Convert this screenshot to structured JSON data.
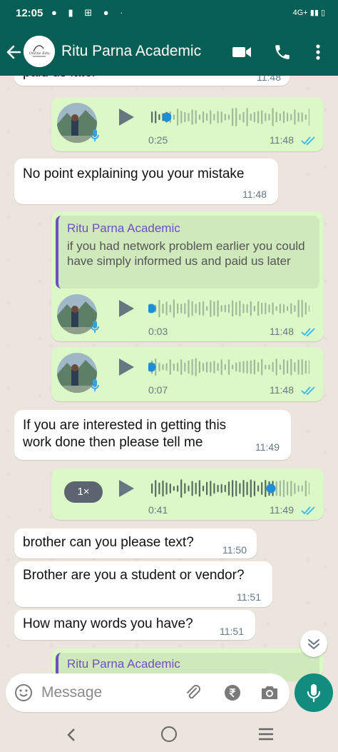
{
  "status": {
    "time": "12:05",
    "network": "4G+"
  },
  "header": {
    "title": "Ritu Parna Academic"
  },
  "messages": {
    "m0": {
      "text": "paid us later",
      "time": "11:48"
    },
    "vn1": {
      "duration": "0:25",
      "time": "11:48",
      "progress": 0.1
    },
    "m2": {
      "text": "No point explaining you your mistake",
      "time": "11:48"
    },
    "vn3": {
      "quote_author": "Ritu Parna Academic",
      "quote_text": "if you had network problem earlier you could have simply informed us and paid us later",
      "duration": "0:03",
      "time": "11:48",
      "progress": 0.0
    },
    "vn4": {
      "duration": "0:07",
      "time": "11:48",
      "progress": 0.0
    },
    "m5": {
      "text": "If you are interested in getting this work done then please tell me",
      "time": "11:49"
    },
    "vn6": {
      "speed": "1×",
      "duration": "0:41",
      "time": "11:49",
      "progress": 0.77
    },
    "m7": {
      "text": "brother can you please text?",
      "time": "11:50"
    },
    "m8": {
      "text": "Brother are you a student or vendor?",
      "time": "11:51"
    },
    "m9": {
      "text": "How many words you have?",
      "time": "11:51"
    },
    "q10": {
      "quote_author": "Ritu Parna Academic"
    }
  },
  "composer": {
    "placeholder": "Message"
  },
  "colors": {
    "header": "#075e54",
    "outgoing": "#dcf8c6",
    "incoming": "#ffffff",
    "accent": "#128c7e",
    "ticks": "#34b7f1"
  },
  "icons": [
    "back-arrow-icon",
    "video-call-icon",
    "phone-icon",
    "more-vert-icon",
    "play-icon",
    "mic-icon",
    "emoji-icon",
    "attach-icon",
    "rupee-icon",
    "camera-icon",
    "double-tick-icon",
    "chevron-down-icon"
  ]
}
